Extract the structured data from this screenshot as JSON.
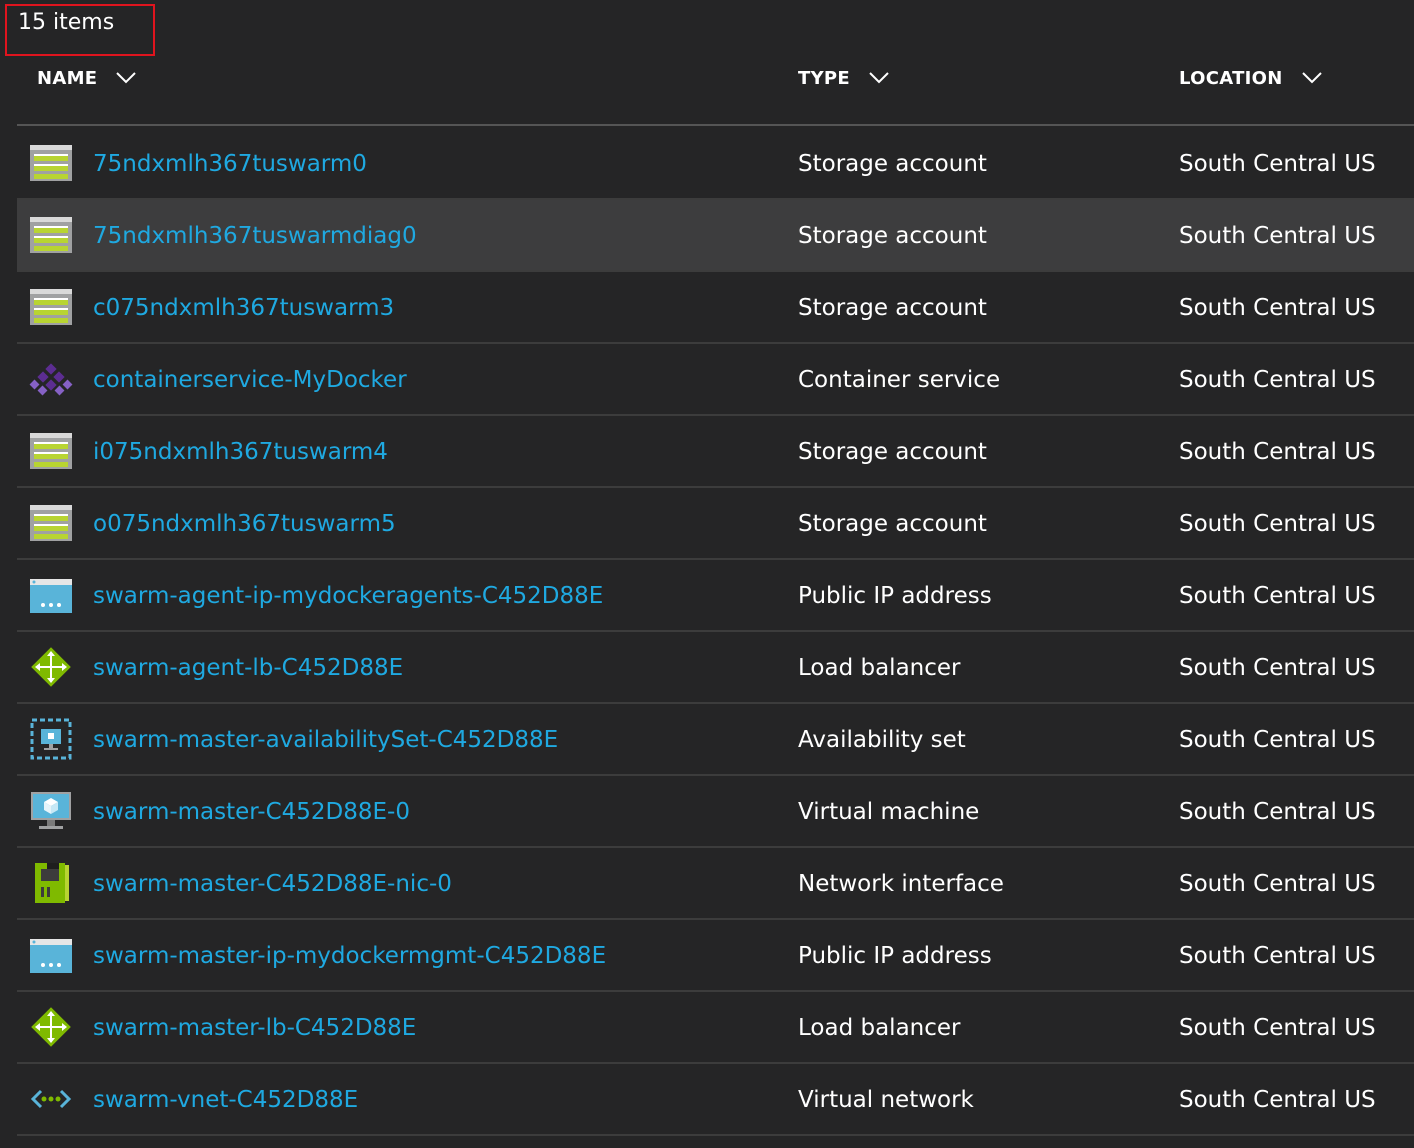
{
  "item_count": "15 items",
  "columns": {
    "name": "NAME",
    "type": "TYPE",
    "location": "LOCATION"
  },
  "rows": [
    {
      "name": "75ndxmlh367tuswarm0",
      "type": "Storage account",
      "location": "South Central US",
      "icon": "storage-account-icon"
    },
    {
      "name": "75ndxmlh367tuswarmdiag0",
      "type": "Storage account",
      "location": "South Central US",
      "icon": "storage-account-icon"
    },
    {
      "name": "c075ndxmlh367tuswarm3",
      "type": "Storage account",
      "location": "South Central US",
      "icon": "storage-account-icon"
    },
    {
      "name": "containerservice-MyDocker",
      "type": "Container service",
      "location": "South Central US",
      "icon": "container-service-icon"
    },
    {
      "name": "i075ndxmlh367tuswarm4",
      "type": "Storage account",
      "location": "South Central US",
      "icon": "storage-account-icon"
    },
    {
      "name": "o075ndxmlh367tuswarm5",
      "type": "Storage account",
      "location": "South Central US",
      "icon": "storage-account-icon"
    },
    {
      "name": "swarm-agent-ip-mydockeragents-C452D88E",
      "type": "Public IP address",
      "location": "South Central US",
      "icon": "public-ip-icon"
    },
    {
      "name": "swarm-agent-lb-C452D88E",
      "type": "Load balancer",
      "location": "South Central US",
      "icon": "load-balancer-icon"
    },
    {
      "name": "swarm-master-availabilitySet-C452D88E",
      "type": "Availability set",
      "location": "South Central US",
      "icon": "availability-set-icon"
    },
    {
      "name": "swarm-master-C452D88E-0",
      "type": "Virtual machine",
      "location": "South Central US",
      "icon": "virtual-machine-icon"
    },
    {
      "name": "swarm-master-C452D88E-nic-0",
      "type": "Network interface",
      "location": "South Central US",
      "icon": "network-interface-icon"
    },
    {
      "name": "swarm-master-ip-mydockermgmt-C452D88E",
      "type": "Public IP address",
      "location": "South Central US",
      "icon": "public-ip-icon"
    },
    {
      "name": "swarm-master-lb-C452D88E",
      "type": "Load balancer",
      "location": "South Central US",
      "icon": "load-balancer-icon"
    },
    {
      "name": "swarm-vnet-C452D88E",
      "type": "Virtual network",
      "location": "South Central US",
      "icon": "virtual-network-icon"
    }
  ],
  "highlighted_row": 1,
  "colors": {
    "background": "#252526",
    "link": "#1fa9e1",
    "highlight_row": "#3d3d3e",
    "count_box_border": "#e0141e"
  }
}
